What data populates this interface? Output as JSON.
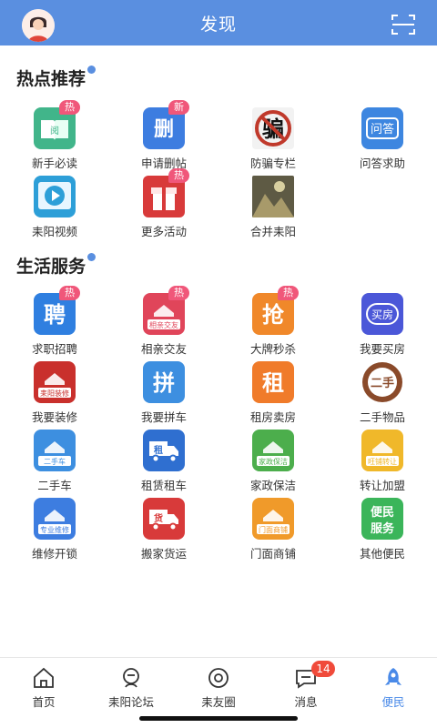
{
  "header": {
    "title": "发现"
  },
  "sections": {
    "hot": {
      "title": "热点推荐"
    },
    "life": {
      "title": "生活服务"
    }
  },
  "hot_items": [
    {
      "label": "新手必读",
      "tag": "热",
      "icon": "book-icon",
      "color": "#41b58a"
    },
    {
      "label": "申请删帖",
      "tag": "新",
      "icon": "delete-post-icon",
      "color": "#3d7de0"
    },
    {
      "label": "防骗专栏",
      "tag": "",
      "icon": "anti-fraud-icon",
      "color": "#c0392b"
    },
    {
      "label": "问答求助",
      "tag": "",
      "icon": "qa-icon",
      "color": "#3d86e0"
    },
    {
      "label": "耒阳视频",
      "tag": "",
      "icon": "video-play-icon",
      "color": "#2d9fd8"
    },
    {
      "label": "更多活动",
      "tag": "热",
      "icon": "gift-icon",
      "color": "#d83a3a"
    },
    {
      "label": "合并耒阳",
      "tag": "",
      "icon": "merge-photo-icon",
      "color": "#7a7a5a"
    }
  ],
  "life_items": [
    {
      "label": "求职招聘",
      "tag": "热",
      "icon": "job-icon",
      "color": "#2f7fe0",
      "glyph": "聘"
    },
    {
      "label": "相亲交友",
      "tag": "热",
      "icon": "dating-icon",
      "color": "#e0455a",
      "glyph": "相亲交友"
    },
    {
      "label": "大牌秒杀",
      "tag": "热",
      "icon": "flash-sale-icon",
      "color": "#f0882a",
      "glyph": "抢"
    },
    {
      "label": "我要买房",
      "tag": "",
      "icon": "buy-house-icon",
      "color": "#4b57d8",
      "glyph": "买房"
    },
    {
      "label": "我要装修",
      "tag": "",
      "icon": "decoration-icon",
      "color": "#c9302c",
      "glyph": "耒阳装修"
    },
    {
      "label": "我要拼车",
      "tag": "",
      "icon": "carpool-icon",
      "color": "#3d8fe0",
      "glyph": "拼"
    },
    {
      "label": "租房卖房",
      "tag": "",
      "icon": "rent-house-icon",
      "color": "#f07b2a",
      "glyph": "租"
    },
    {
      "label": "二手物品",
      "tag": "",
      "icon": "second-hand-icon",
      "color": "#8a4a2a",
      "glyph": "二手"
    },
    {
      "label": "二手车",
      "tag": "",
      "icon": "used-car-icon",
      "color": "#3d8fe0",
      "glyph": "二手车"
    },
    {
      "label": "租赁租车",
      "tag": "",
      "icon": "truck-rental-icon",
      "color": "#2f6fd0",
      "glyph": "租"
    },
    {
      "label": "家政保洁",
      "tag": "",
      "icon": "housekeeping-icon",
      "color": "#4cae4c",
      "glyph": "家政保洁"
    },
    {
      "label": "转让加盟",
      "tag": "",
      "icon": "shop-transfer-icon",
      "color": "#f0b82a",
      "glyph": "旺铺转让"
    },
    {
      "label": "维修开锁",
      "tag": "",
      "icon": "repair-icon",
      "color": "#3d7de0",
      "glyph": "专业维修"
    },
    {
      "label": "搬家货运",
      "tag": "",
      "icon": "moving-icon",
      "color": "#d83a3a",
      "glyph": "货"
    },
    {
      "label": "门面商铺",
      "tag": "",
      "icon": "storefront-icon",
      "color": "#f09a2a",
      "glyph": "门面商铺"
    },
    {
      "label": "其他便民",
      "tag": "",
      "icon": "convenience-icon",
      "color": "#3bb55a",
      "glyph": "便民服务"
    }
  ],
  "tabs": [
    {
      "label": "首页",
      "icon": "home-icon",
      "active": false
    },
    {
      "label": "耒阳论坛",
      "icon": "forum-icon",
      "active": false
    },
    {
      "label": "耒友圈",
      "icon": "moments-icon",
      "active": false
    },
    {
      "label": "消息",
      "icon": "message-icon",
      "active": false,
      "badge": "14"
    },
    {
      "label": "便民",
      "icon": "rocket-icon",
      "active": true
    }
  ]
}
